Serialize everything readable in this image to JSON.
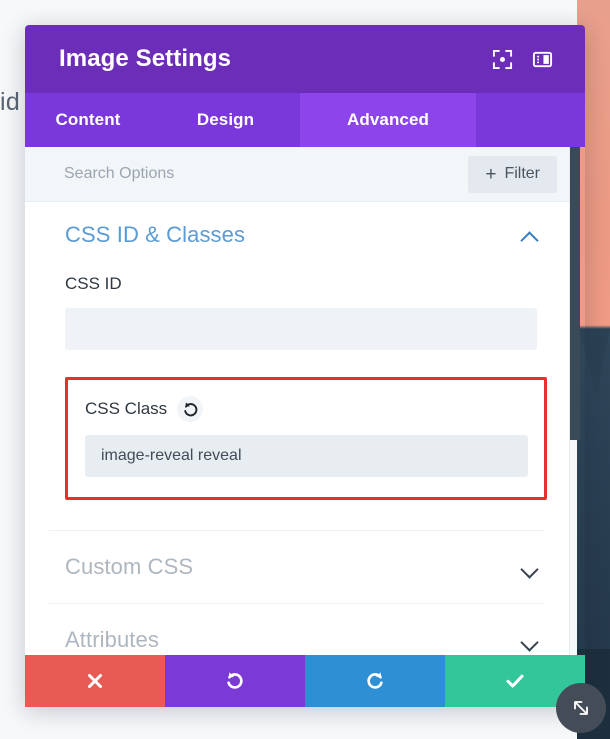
{
  "backdrop": {
    "visible_text": "id",
    "photo_sky_color": "#ef9b86",
    "photo_mountain_color": "#2b4254"
  },
  "modal": {
    "title": "Image Settings",
    "header_color": "#6c2eb9",
    "header_icons": [
      {
        "name": "focus-target-icon",
        "label": "Focus"
      },
      {
        "name": "layout-panel-icon",
        "label": "Panel Layout"
      }
    ],
    "tabs": [
      {
        "label": "Content",
        "active": false
      },
      {
        "label": "Design",
        "active": false
      },
      {
        "label": "Advanced",
        "active": true
      }
    ],
    "active_tab_color": "#8b45ea",
    "tabbar_color": "#7a37d9"
  },
  "search": {
    "placeholder": "Search Options",
    "value": "",
    "filter_label": "Filter",
    "filter_plus": "+"
  },
  "sections": [
    {
      "title": "CSS ID & Classes",
      "state": "open",
      "accent_color": "#5a9bd5",
      "fields": [
        {
          "label": "CSS ID",
          "value": "",
          "placeholder": "",
          "has_reset": false,
          "highlighted": false
        },
        {
          "label": "CSS Class",
          "value": "image-reveal reveal",
          "placeholder": "",
          "has_reset": true,
          "highlighted": true,
          "highlight_color": "#e8312c"
        }
      ]
    },
    {
      "title": "Custom CSS",
      "state": "closed",
      "accent_color": "#aeb7c0",
      "fields": []
    },
    {
      "title": "Attributes",
      "state": "closed",
      "accent_color": "#aeb7c0",
      "fields": []
    }
  ],
  "footer": {
    "buttons": [
      {
        "name": "cancel",
        "icon": "close-x-icon",
        "color": "#e85a54"
      },
      {
        "name": "undo",
        "icon": "undo-icon",
        "color": "#7b3ad6"
      },
      {
        "name": "redo",
        "icon": "redo-icon",
        "color": "#2f8fd4"
      },
      {
        "name": "save",
        "icon": "checkmark-icon",
        "color": "#34c69b"
      }
    ]
  },
  "resize_handle": {
    "icon": "resize-diagonal-icon",
    "color": "#444c57"
  }
}
